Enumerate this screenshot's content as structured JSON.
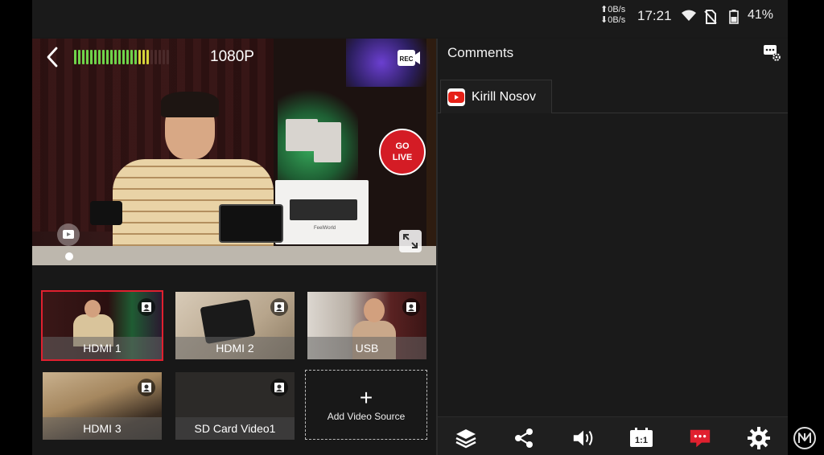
{
  "status_bar": {
    "net_up": "⬆0B/s",
    "net_down": "⬇0B/s",
    "time": "17:21",
    "battery": "41%"
  },
  "preview": {
    "resolution": "1080P",
    "rec_label": "REC",
    "go_live_line1": "GO",
    "go_live_line2": "LIVE",
    "audio_level": 0.8,
    "box_brand": "FeelWorld"
  },
  "sources": [
    {
      "label": "HDMI 1",
      "selected": true
    },
    {
      "label": "HDMI 2",
      "selected": false
    },
    {
      "label": "USB",
      "selected": false
    },
    {
      "label": "HDMI 3",
      "selected": false
    },
    {
      "label": "SD Card Video1",
      "selected": false
    }
  ],
  "add_source": {
    "label": "Add Video Source"
  },
  "comments": {
    "title": "Comments",
    "tabs": [
      {
        "label": "Kirill Nosov",
        "platform": "youtube"
      }
    ]
  },
  "toolbar": {
    "items": [
      "layers-icon",
      "share-icon",
      "volume-icon",
      "aspect-ratio-icon",
      "comments-icon",
      "settings-icon"
    ],
    "aspect_label": "1:1",
    "active_color": "#e0202f"
  },
  "colors": {
    "accent": "#e0202f",
    "panel": "#191919"
  }
}
